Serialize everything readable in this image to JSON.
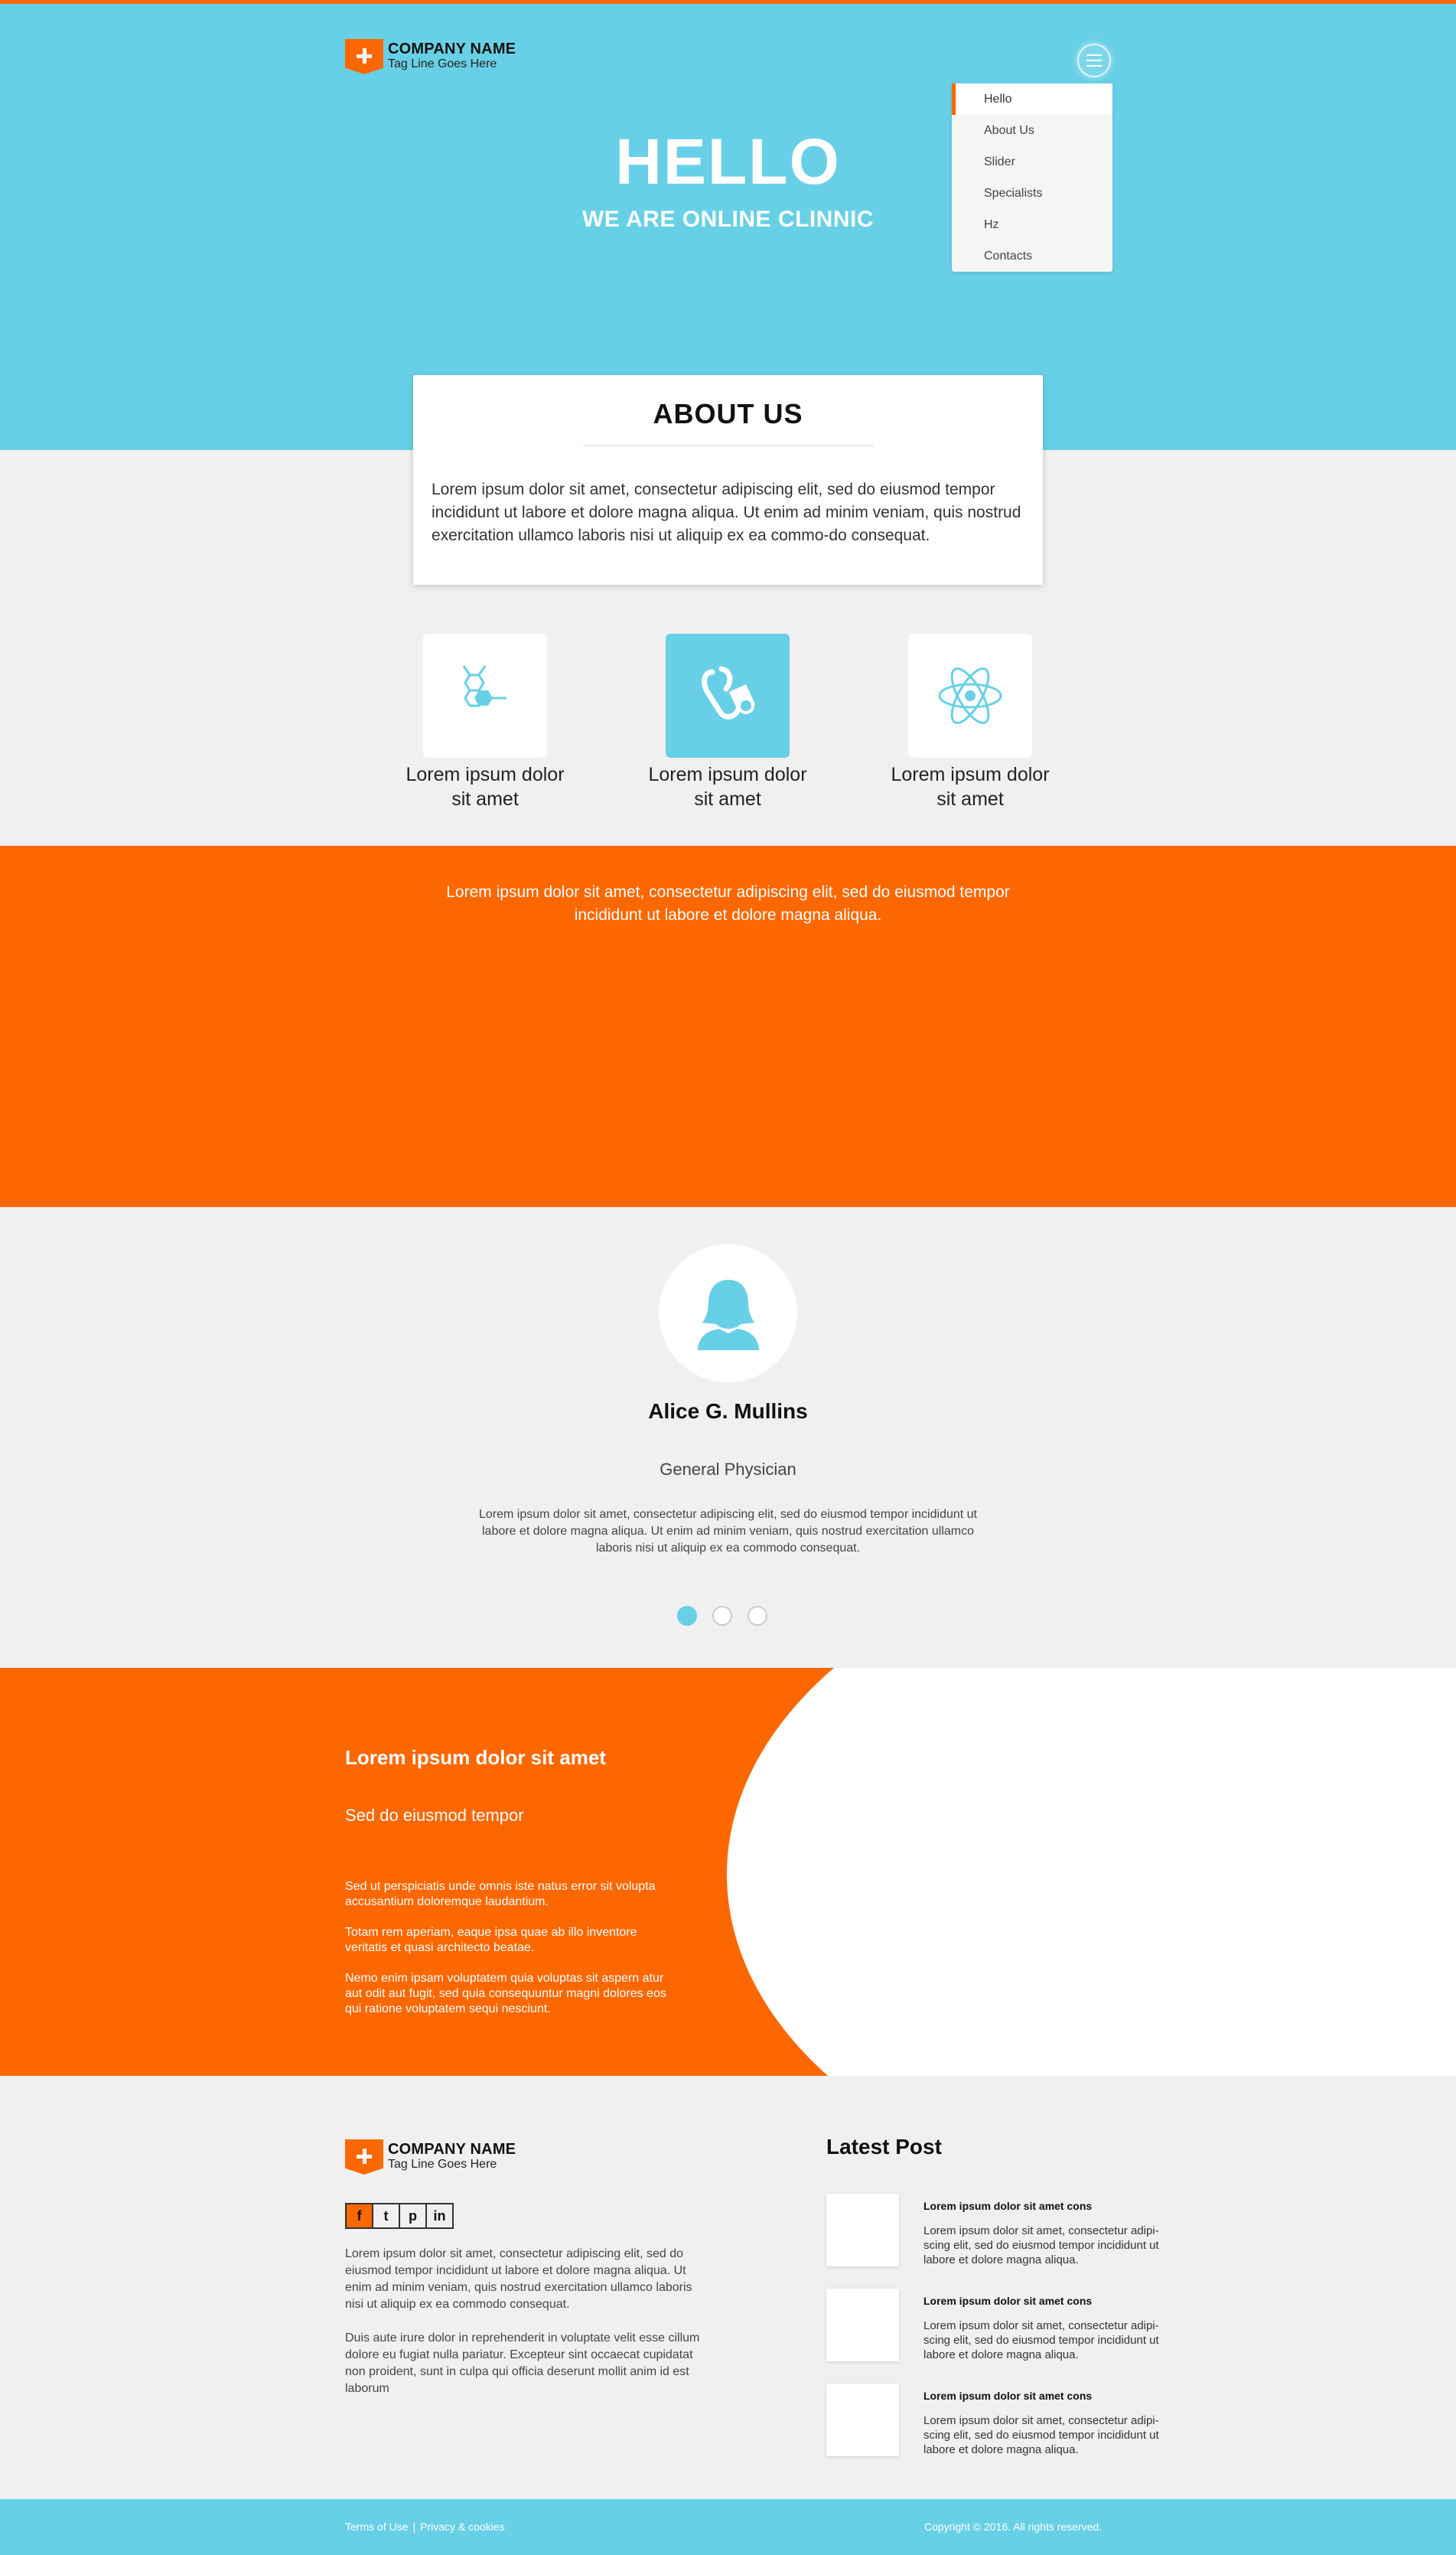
{
  "brand": {
    "name": "COMPANY NAME",
    "tagline": "Tag Line Goes Here",
    "orange": "#fd6700",
    "blue": "#68d0e6"
  },
  "nav": {
    "items": [
      "Hello",
      "About Us",
      "Slider",
      "Specialists",
      "Hz",
      "Contacts"
    ],
    "active": "Hello"
  },
  "hero": {
    "title": "HELLO",
    "subtitle": "WE ARE ONLINE CLINNIC"
  },
  "about": {
    "title": "ABOUT US",
    "text": "Lorem ipsum dolor sit amet, consectetur adipiscing elit, sed do eiusmod tempor incididunt ut labore et dolore magna aliqua. Ut enim ad minim veniam, quis nostrud exercitation ullamco laboris nisi ut aliquip ex ea commo-do consequat."
  },
  "features": [
    {
      "icon": "molecule-icon",
      "label": "Lorem ipsum dolor sit amet"
    },
    {
      "icon": "stethoscope-icon",
      "label": "Lorem ipsum dolor sit amet"
    },
    {
      "icon": "atom-icon",
      "label": "Lorem ipsum dolor sit amet"
    }
  ],
  "band": {
    "text": "Lorem ipsum dolor sit amet, consectetur adipiscing elit, sed do eiusmod tempor incididunt ut labore et dolore magna aliqua."
  },
  "specialist": {
    "name": "Alice G. Mullins",
    "role": "General Physician",
    "bio": "Lorem ipsum dolor sit amet, consectetur adipiscing elit, sed do eiusmod tempor incididunt ut labore et dolore magna aliqua. Ut enim ad minim veniam, quis nostrud exercitation ullamco laboris nisi ut aliquip ex ea commodo consequat."
  },
  "split": {
    "title": "Lorem ipsum dolor sit amet",
    "subtitle": "Sed do eiusmod tempor",
    "paragraphs": [
      "Sed ut perspiciatis unde omnis iste natus error sit volupta accusantium doloremque laudantium.",
      "Totam rem aperiam, eaque ipsa quae ab illo inventore veritatis et quasi architecto beatae.",
      "Nemo enim ipsam voluptatem quia voluptas sit aspern atur aut odit aut fugit, sed quia consequuntur magni dolores eos qui ratione voluptatem sequi nesciunt."
    ]
  },
  "footer": {
    "social": [
      "f",
      "t",
      "p",
      "in"
    ],
    "paragraphs": [
      "Lorem ipsum dolor sit amet, consectetur adipiscing elit, sed do eiusmod tempor incididunt ut labore et dolore magna aliqua. Ut enim ad minim veniam, quis nostrud exercitation ullamco laboris nisi ut aliquip ex ea commodo consequat.",
      "Duis aute irure dolor in reprehenderit in voluptate velit esse cillum dolore eu fugiat nulla pariatur. Excepteur sint occaecat cupidatat non proident, sunt in culpa qui officia deserunt mollit anim id est laborum"
    ],
    "latest_title": "Latest Post",
    "posts": [
      {
        "title": "Lorem ipsum dolor sit amet cons",
        "text": "Lorem ipsum dolor sit amet, consectetur adipi-scing elit, sed do eiusmod tempor incididunt ut labore et dolore magna aliqua."
      },
      {
        "title": "Lorem ipsum dolor sit amet cons",
        "text": "Lorem ipsum dolor sit amet, consectetur adipi-scing elit, sed do eiusmod tempor incididunt ut labore et dolore magna aliqua."
      },
      {
        "title": "Lorem ipsum dolor sit amet cons",
        "text": "Lorem ipsum dolor sit amet, consectetur adipi-scing elit, sed do eiusmod tempor incididunt ut labore et dolore magna aliqua."
      }
    ],
    "terms": "Terms of Use",
    "separator": "|",
    "privacy": "Privacy & cookies",
    "copyright": "Copyright © 2016. All rights reserved."
  }
}
